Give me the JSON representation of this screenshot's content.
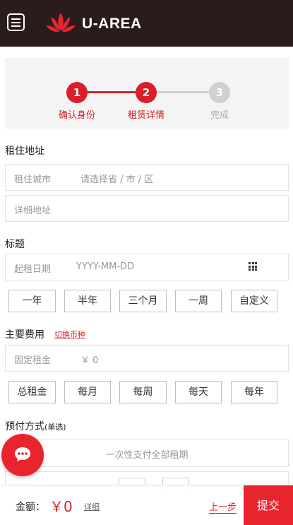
{
  "header": {
    "brand": "U-AREA"
  },
  "steps": [
    {
      "number": "1",
      "label": "确认身份",
      "state": "done"
    },
    {
      "number": "2",
      "label": "租赁详情",
      "state": "active"
    },
    {
      "number": "3",
      "label": "完成",
      "state": "pending"
    }
  ],
  "address": {
    "section_title": "租住地址",
    "city_label": "租住城市",
    "city_placeholder": "请选择省 / 市 / 区",
    "detail_placeholder": "详细地址"
  },
  "title_section": {
    "section_title": "标题",
    "start_label": "起租日期",
    "start_placeholder": "YYYY-MM-DD",
    "durations": [
      "一年",
      "半年",
      "三个月",
      "一周",
      "自定义"
    ]
  },
  "fees": {
    "section_title": "主要费用",
    "switch_currency": "切换币种",
    "rent_label": "固定租金",
    "rent_value": "￥ 0",
    "periods": [
      "总租金",
      "每月",
      "每周",
      "每天",
      "每年"
    ]
  },
  "payment": {
    "section_title": "预付方式",
    "single_note": "(单选)",
    "option_full": "一次性支付全部租期"
  },
  "bottom": {
    "amount_label": "金额：",
    "amount_value": "￥0",
    "detail_link": "详细",
    "prev_link": "上一步",
    "submit": "提交"
  },
  "colors": {
    "accent": "#e8252d",
    "header_bg": "#2a1c1a",
    "pending": "#d0d0d0"
  }
}
